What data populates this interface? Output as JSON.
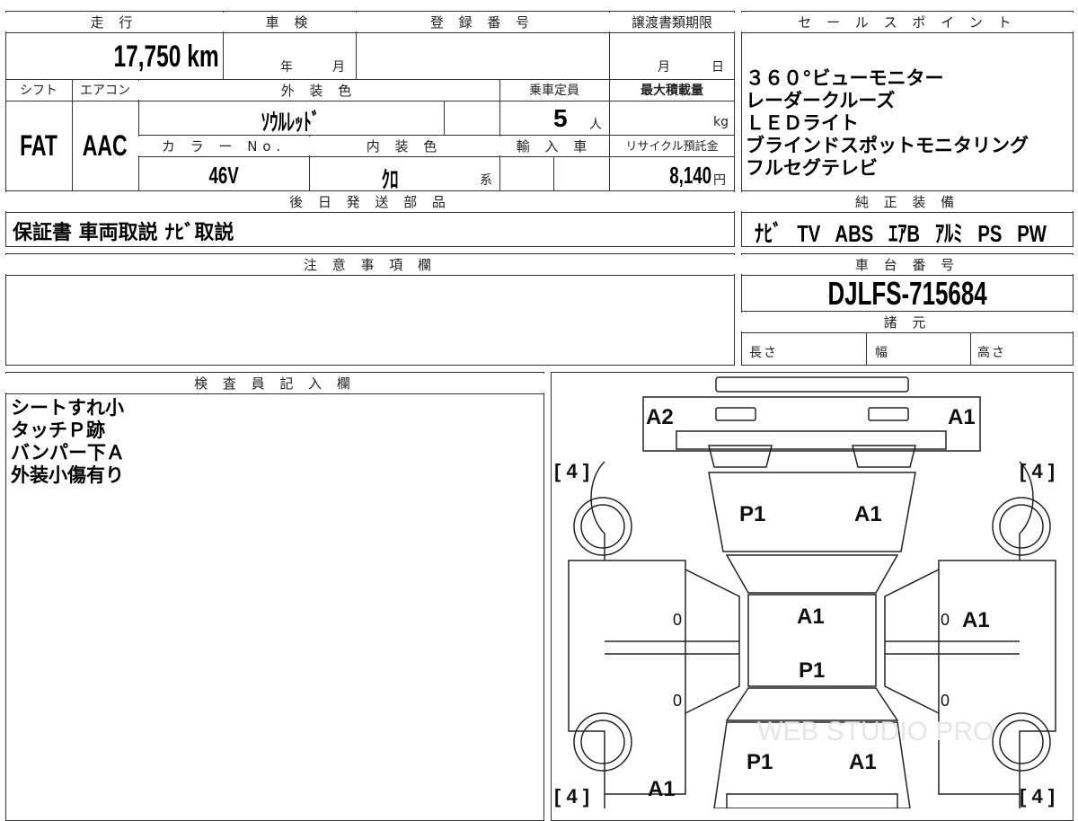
{
  "vehicle": {
    "mileage_label": "走 行",
    "mileage_value": "17,750 km",
    "shaken_label": "車 検",
    "shaken_year": "年",
    "shaken_month": "月",
    "registration_label": "登 録 番 号",
    "transfer_label": "譲渡書類期限",
    "transfer_month": "月",
    "transfer_day": "日",
    "shift_label": "シフト",
    "shift_value": "FAT",
    "aircon_label": "エアコン",
    "aircon_value": "AAC",
    "exterior_color_label": "外 装 色",
    "exterior_color_value": "ｿｳﾙﾚｯﾄﾞ",
    "capacity_label": "乗車定員",
    "capacity_value": "5",
    "capacity_unit": "人",
    "max_load_label": "最大積載量",
    "max_load_unit": "kg",
    "color_no_label": "カ ラ ー No.",
    "color_no_value": "46V",
    "interior_color_label": "内 装 色",
    "interior_color_value": "ｸﾛ",
    "interior_color_suffix": "系",
    "import_label": "輸 入 車",
    "recycle_label": "リサイクル預託金",
    "recycle_value": "8,140",
    "recycle_unit": "円",
    "later_parts_label": "後 日 発 送 部 品",
    "later_parts_value": "保証書 車両取説 ﾅﾋﾞ取説",
    "notes_label": "注 意 事 項 欄"
  },
  "sales_points": {
    "label": "セ ー ル ス ポ イ ン ト",
    "lines": [
      "３６０°ビューモニター",
      "レーダークルーズ",
      "ＬＥＤライト",
      "ブラインドスポットモニタリング",
      "フルセグテレビ"
    ]
  },
  "equipment": {
    "label": "純 正 装 備",
    "items": [
      "ﾅﾋﾞ",
      "TV",
      "ABS",
      "ｴｱB",
      "ｱﾙﾐ",
      "PS",
      "PW"
    ]
  },
  "chassis": {
    "label": "車 台 番 号",
    "value": "DJLFS-715684"
  },
  "specs": {
    "label": "諸 元",
    "length_label": "長さ",
    "width_label": "幅",
    "height_label": "高さ"
  },
  "inspector": {
    "label": "検 査 員 記 入 欄",
    "lines": [
      "シートすれ小",
      "タッチＰ跡",
      "バンパー下Ａ",
      "外装小傷有り"
    ]
  },
  "diagram": {
    "tire_depth": "[ 4 ]",
    "marks": {
      "front_left_corner": "A2",
      "front_right_corner": "A1",
      "hood_left": "P1",
      "hood_right": "A1",
      "roof": "A1",
      "right_front_door": "A1",
      "roof_rear": "P1",
      "trunk_left": "P1",
      "trunk_right": "A1",
      "rear_left": "A1",
      "door_zero": "0"
    },
    "watermark": "WEB STUDIO PRO"
  }
}
